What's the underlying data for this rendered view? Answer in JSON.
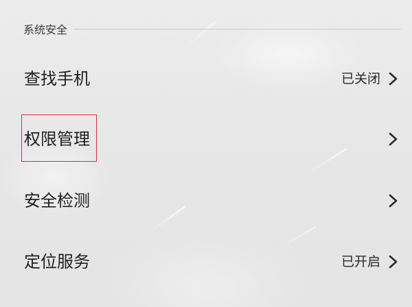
{
  "section": {
    "title": "系统安全"
  },
  "rows": [
    {
      "label": "查找手机",
      "value": "已关闭",
      "chevron_icon": "chevron-right-icon"
    },
    {
      "label": "权限管理",
      "value": "",
      "chevron_icon": "chevron-right-icon"
    },
    {
      "label": "安全检测",
      "value": "",
      "chevron_icon": "chevron-right-icon"
    },
    {
      "label": "定位服务",
      "value": "已开启",
      "chevron_icon": "chevron-right-icon"
    }
  ],
  "colors": {
    "background": "#e9e9e9",
    "text_primary": "#1f1f1f",
    "highlight_border": "#d0342c"
  }
}
